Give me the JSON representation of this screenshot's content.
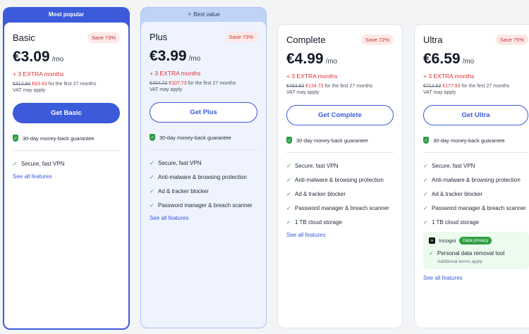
{
  "colors": {
    "accent": "#3b5bdb",
    "sale": "#e03131",
    "check": "#2f9e44"
  },
  "basic": {
    "banner": "Most popular",
    "name": "Basic",
    "save": "Save 73%",
    "price": "€3.09",
    "per": "/mo",
    "extra": "+ 3 EXTRA months",
    "old": "€312.93",
    "new": "€83.43",
    "first": " for the first 27 months",
    "vat": "VAT may apply",
    "button": "Get Basic",
    "guarantee": "30-day money-back guarantee",
    "features": [
      "Secure, fast VPN"
    ],
    "see_all": "See all features"
  },
  "plus": {
    "banner": "Best value",
    "name": "Plus",
    "save": "Save 73%",
    "price": "€3.99",
    "per": "/mo",
    "extra": "+ 3 EXTRA months",
    "old": "€404.73",
    "new": "€107.73",
    "first": " for the first 27 months",
    "vat": "VAT may apply",
    "button": "Get Plus",
    "guarantee": "30-day money-back guarantee",
    "features": [
      "Secure, fast VPN",
      "Anti-malware & browsing protection",
      "Ad & tracker blocker",
      "Password manager & breach scanner"
    ],
    "see_all": "See all features"
  },
  "complete": {
    "name": "Complete",
    "save": "Save 72%",
    "price": "€4.99",
    "per": "/mo",
    "extra": "+ 3 EXTRA months",
    "old": "€493.83",
    "new": "€134.73",
    "first": " for the first 27 months",
    "vat": "VAT may apply",
    "button": "Get Complete",
    "guarantee": "30-day money-back guarantee",
    "features": [
      "Secure, fast VPN",
      "Anti-malware & browsing protection",
      "Ad & tracker blocker",
      "Password manager & breach scanner",
      "1 TB cloud storage"
    ],
    "see_all": "See all features"
  },
  "ultra": {
    "name": "Ultra",
    "save": "Save 75%",
    "price": "€6.59",
    "per": "/mo",
    "extra": "+ 3 EXTRA months",
    "old": "€712.53",
    "new": "€177.93",
    "first": " for the first 27 months",
    "vat": "VAT may apply",
    "button": "Get Ultra",
    "guarantee": "30-day money-back guarantee",
    "features": [
      "Secure, fast VPN",
      "Anti-malware & browsing protection",
      "Ad & tracker blocker",
      "Password manager & breach scanner",
      "1 TB cloud storage"
    ],
    "incogni": {
      "logo": "in",
      "name": "Incogni",
      "badge": "Data privacy",
      "feature": "Personal data removal tool",
      "note": "Additional terms apply"
    },
    "see_all": "See all features"
  }
}
